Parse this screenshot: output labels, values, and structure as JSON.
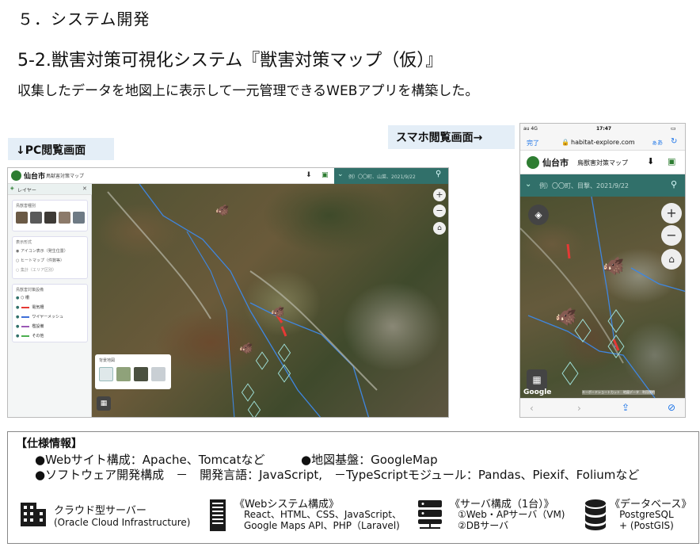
{
  "header": {
    "section": "５．システム開発",
    "title": "5-2.獣害対策可視化システム『獣害対策マップ（仮）』",
    "description": "収集したデータを地図上に表示して一元管理できるWEBアプリを構築した。"
  },
  "labels": {
    "pc": "↓PC閲覧画面",
    "sp": "スマホ閲覧画面→"
  },
  "pc_app": {
    "city": "仙台市",
    "app_name": "鳥獣害対策マップ",
    "search_text": "例）〇〇町、山菜、2021/9/22",
    "layer_panel_title": "レイヤー",
    "animals_title": "鳥獣害種別",
    "display_title": "表示形式",
    "display_options": [
      "アイコン表示（発生位置）",
      "ヒートマップ（件数等）",
      "集計（エリア区別）"
    ],
    "facilities_title": "鳥獣害対策設備",
    "facilities": [
      "柵",
      "電気柵",
      "ワイヤーメッシュ",
      "檻設備",
      "その他"
    ],
    "basemap_title": "背景地図",
    "colors": {
      "header_teal": "#31706a",
      "marker_green": "#7cc043",
      "wire_blue": "#2e7dd1",
      "electric_red": "#e53935",
      "mesh_blue": "#3f6fd8",
      "cage_purple": "#9b59b6",
      "other_green": "#4caf50"
    }
  },
  "sp_app": {
    "carrier": "au 4G",
    "time": "17:47",
    "done": "完了",
    "url": "habitat-explore.com",
    "aa": "ぁあ",
    "city": "仙台市",
    "app_name": "鳥獣害対策マップ",
    "search_text": "例）〇〇町、目撃、2021/9/22",
    "google": "Google",
    "attribution": "キーボードショートカット　地図データ　利用規約"
  },
  "spec": {
    "heading": "【仕様情報】",
    "lines": [
      "●Webサイト構成：Apache、Tomcatなど",
      "●地図基盤：GoogleMap",
      "●ソフトウェア開発構成　－　開発言語：JavaScript,",
      "－TypeScriptモジュール：Pandas、Piexif、Foliumなど"
    ],
    "items": [
      {
        "icon": "building-icon",
        "title": "クラウド型サーバー",
        "sub": "(Oracle Cloud Infrastructure)"
      },
      {
        "icon": "server-rack-icon",
        "title": "《Webシステム構成》",
        "sub": "React、HTML、CSS、JavaScript、\nGoogle Maps API、PHP（Laravel)"
      },
      {
        "icon": "server-stack-icon",
        "title": "《サーバ構成（1台）》",
        "sub": "①Web・APサーバ（VM)\n②DBサーバ"
      },
      {
        "icon": "database-icon",
        "title": "《データベース》",
        "sub": "PostgreSQL\n+ (PostGIS)"
      }
    ]
  }
}
